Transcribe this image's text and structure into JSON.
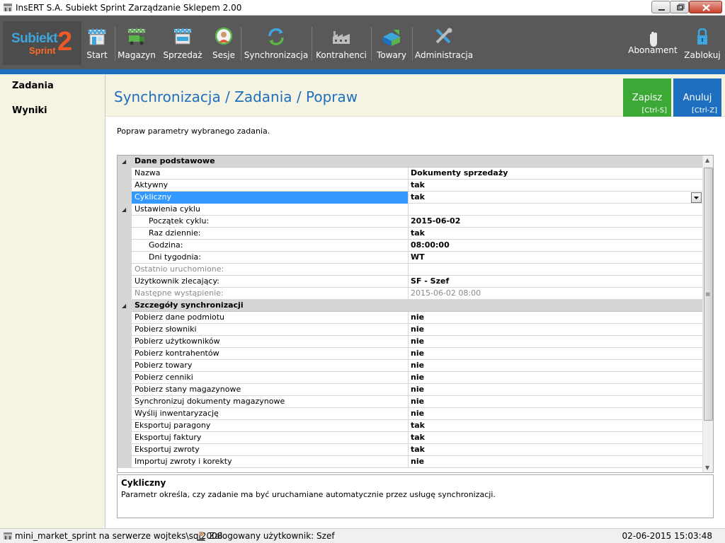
{
  "window": {
    "title": "InsERT S.A. Subiekt Sprint Zarządzanie Sklepem 2.00"
  },
  "logo": {
    "line1": "Subiekt",
    "line2": "Sprint",
    "num": "2"
  },
  "toolbar": {
    "start": "Start",
    "magazyn": "Magazyn",
    "sprzedaz": "Sprzedaż",
    "sesje": "Sesje",
    "synchronizacja": "Synchronizacja",
    "kontrahenci": "Kontrahenci",
    "towary": "Towary",
    "administracja": "Administracja",
    "abonament": "Abonament",
    "zablokuj": "Zablokuj"
  },
  "sidebar": {
    "items": [
      "Zadania",
      "Wyniki"
    ]
  },
  "page": {
    "title": "Synchronizacja / Zadania / Popraw",
    "hint": "Popraw parametry wybranego zadania.",
    "save_label": "Zapisz",
    "save_key": "[Ctrl-S]",
    "cancel_label": "Anuluj",
    "cancel_key": "[Ctrl-Z]"
  },
  "grid": {
    "section1": "Dane podstawowe",
    "r_nazwa": {
      "name": "Nazwa",
      "value": "Dokumenty sprzedaży"
    },
    "r_aktywny": {
      "name": "Aktywny",
      "value": "tak"
    },
    "r_cykliczny": {
      "name": "Cykliczny",
      "value": "tak"
    },
    "r_ustawienia": {
      "name": "Ustawienia cyklu",
      "value": ""
    },
    "r_poczatek": {
      "name": "Początek cyklu:",
      "value": "2015-06-02"
    },
    "r_raz": {
      "name": "Raz dziennie:",
      "value": "tak"
    },
    "r_godzina": {
      "name": "Godzina:",
      "value": "08:00:00"
    },
    "r_dni": {
      "name": "Dni tygodnia:",
      "value": "WT"
    },
    "r_ostatnio": {
      "name": "Ostatnio uruchomione:",
      "value": ""
    },
    "r_uzytkownik": {
      "name": "Użytkownik zlecający:",
      "value": "SF - Szef"
    },
    "r_nastepne": {
      "name": "Następne wystąpienie:",
      "value": "2015-06-02 08:00"
    },
    "section2": "Szczegóły synchronizacji",
    "r_s1": {
      "name": "Pobierz dane podmiotu",
      "value": "nie"
    },
    "r_s2": {
      "name": "Pobierz słowniki",
      "value": "nie"
    },
    "r_s3": {
      "name": "Pobierz użytkowników",
      "value": "nie"
    },
    "r_s4": {
      "name": "Pobierz kontrahentów",
      "value": "nie"
    },
    "r_s5": {
      "name": "Pobierz towary",
      "value": "nie"
    },
    "r_s6": {
      "name": "Pobierz cenniki",
      "value": "nie"
    },
    "r_s7": {
      "name": "Pobierz stany magazynowe",
      "value": "nie"
    },
    "r_s8": {
      "name": "Synchronizuj dokumenty magazynowe",
      "value": "nie"
    },
    "r_s9": {
      "name": "Wyślij inwentaryzację",
      "value": "nie"
    },
    "r_s10": {
      "name": "Eksportuj paragony",
      "value": "tak"
    },
    "r_s11": {
      "name": "Eksportuj faktury",
      "value": "tak"
    },
    "r_s12": {
      "name": "Eksportuj zwroty",
      "value": "tak"
    },
    "r_s13": {
      "name": "Importuj zwroty i korekty",
      "value": "nie"
    }
  },
  "description": {
    "title": "Cykliczny",
    "text": "Parametr określa, czy zadanie ma być uruchamiane automatycznie przez usługę synchronizacji."
  },
  "status": {
    "db": "mini_market_sprint na serwerze wojteks\\sql2008",
    "user": "Zalogowany użytkownik:  Szef",
    "datetime": "02-06-2015 15:03:48"
  },
  "colors": {
    "accent": "#1e6fc0",
    "save": "#3aa935",
    "toolbar": "#595959",
    "selection": "#3399ff"
  }
}
